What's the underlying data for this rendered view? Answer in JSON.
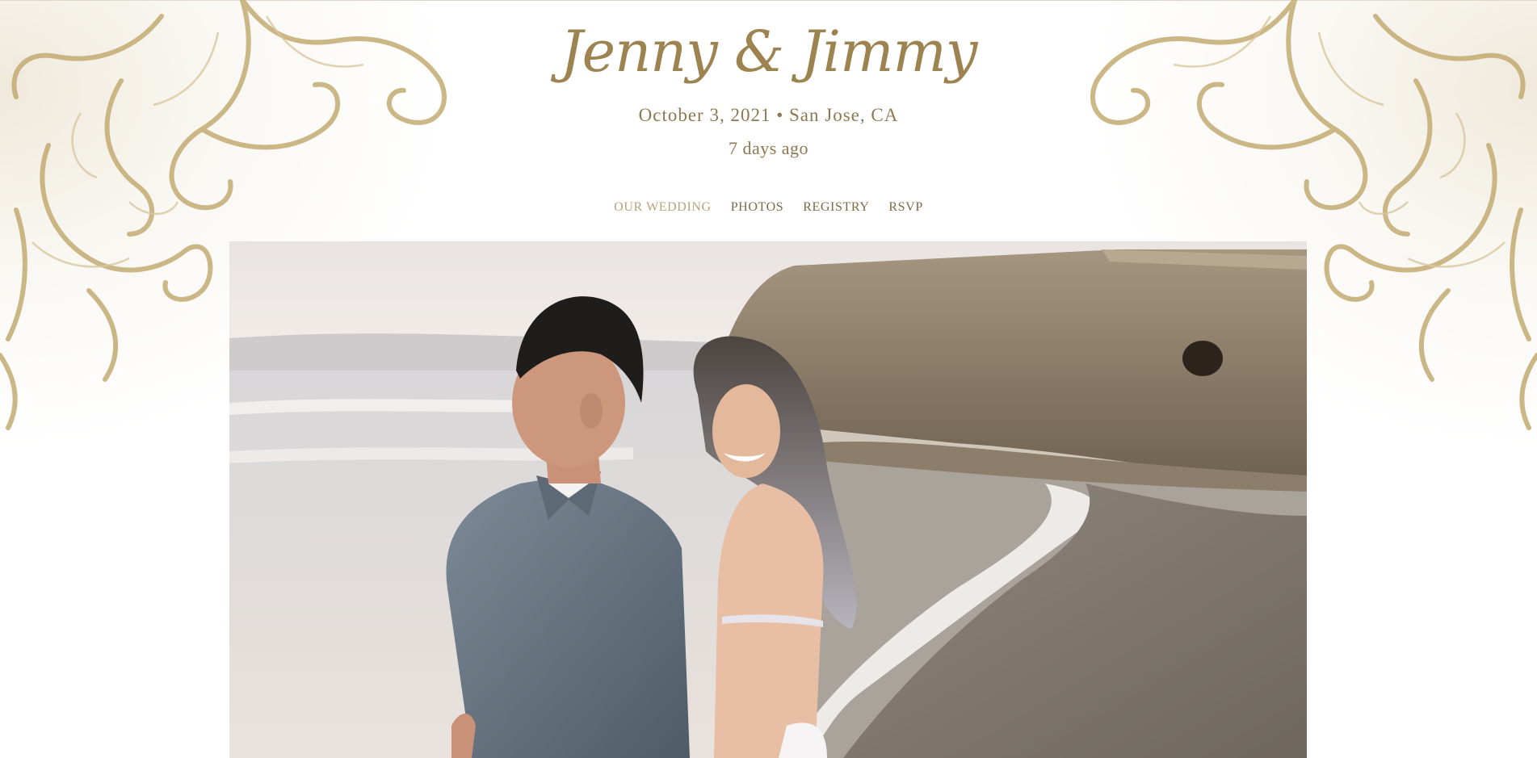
{
  "header": {
    "couple_names": "Jenny & Jimmy",
    "event_info": "October 3, 2021 • San Jose, CA",
    "countdown": "7 days ago"
  },
  "nav": {
    "items": [
      {
        "label": "OUR WEDDING",
        "active": true
      },
      {
        "label": "PHOTOS",
        "active": false
      },
      {
        "label": "REGISTRY",
        "active": false
      },
      {
        "label": "RSVP",
        "active": false
      }
    ]
  },
  "colors": {
    "accent_gold": "#9c8350",
    "nav_text": "#7c6a47",
    "nav_active": "#b9a378"
  },
  "icons": {
    "ornament": "gold-filigree-ornament"
  }
}
